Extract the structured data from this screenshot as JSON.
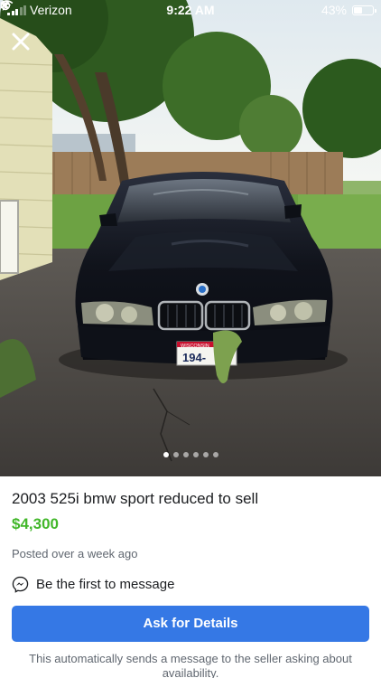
{
  "status_bar": {
    "carrier": "Verizon",
    "time": "9:22 AM",
    "battery_percent": "43%",
    "battery_level": 0.43
  },
  "photo": {
    "description_icon": "car-photo",
    "carousel_total": 6,
    "carousel_active": 0,
    "plate_state": "WISCONSIN",
    "plate_number": "194-"
  },
  "listing": {
    "title": "2003 525i bmw sport reduced to sell",
    "price": "$4,300",
    "posted": "Posted over a week ago",
    "messenger_text": "Be the first to message"
  },
  "cta": {
    "label": "Ask for Details",
    "color": "#3578e5"
  },
  "disclaimer": "This automatically sends a message to the seller asking about availability.",
  "colors": {
    "price": "#42b72a",
    "car_body": "#12151f"
  }
}
